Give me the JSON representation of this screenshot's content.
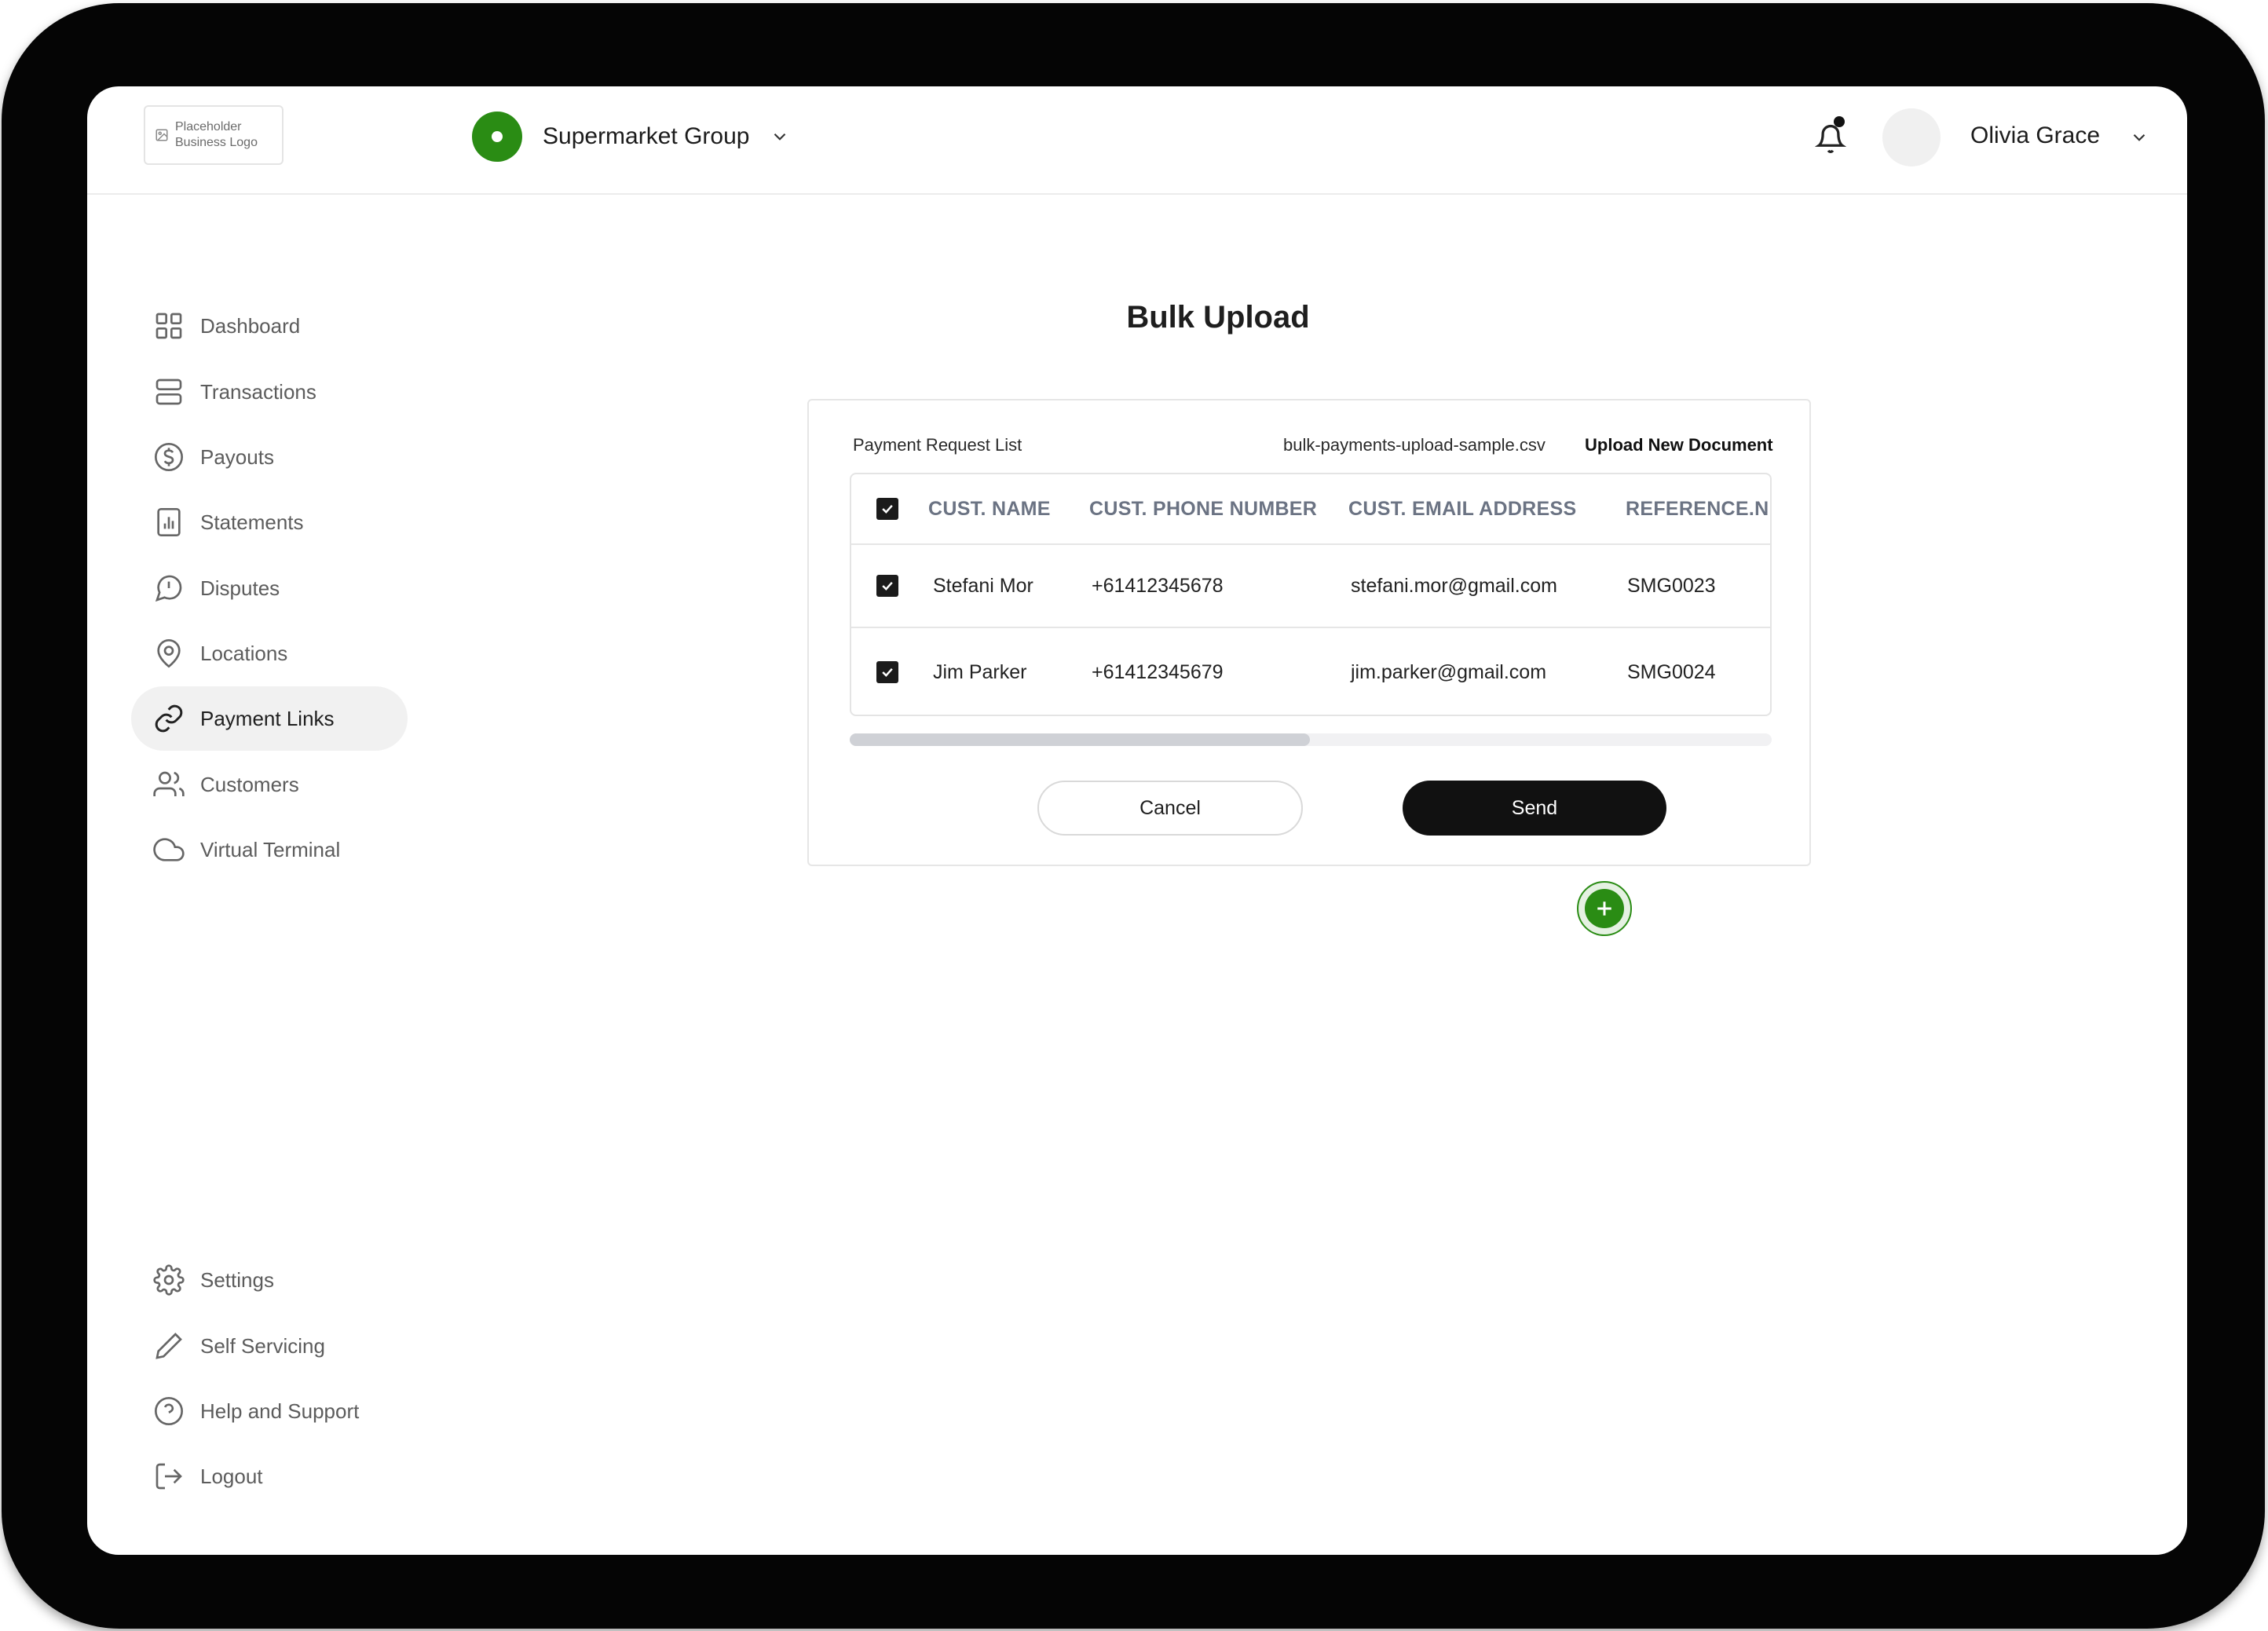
{
  "header": {
    "logo_text": "Placeholder Business Logo",
    "org_name": "Supermarket Group",
    "user_name": "Olivia Grace"
  },
  "sidebar": {
    "items": [
      {
        "label": "Dashboard",
        "icon": "grid-icon"
      },
      {
        "label": "Transactions",
        "icon": "transactions-icon"
      },
      {
        "label": "Payouts",
        "icon": "dollar-circle-icon"
      },
      {
        "label": "Statements",
        "icon": "bar-chart-icon"
      },
      {
        "label": "Disputes",
        "icon": "alert-message-icon"
      },
      {
        "label": "Locations",
        "icon": "map-pin-icon"
      },
      {
        "label": "Payment Links",
        "icon": "link-icon",
        "active": true
      },
      {
        "label": "Customers",
        "icon": "users-icon"
      },
      {
        "label": "Virtual Terminal",
        "icon": "cloud-icon"
      }
    ],
    "bottom_items": [
      {
        "label": "Settings",
        "icon": "gear-icon"
      },
      {
        "label": "Self Servicing",
        "icon": "pencil-icon"
      },
      {
        "label": "Help and Support",
        "icon": "help-circle-icon"
      },
      {
        "label": "Logout",
        "icon": "logout-icon"
      }
    ]
  },
  "main": {
    "title": "Bulk Upload",
    "card": {
      "label": "Payment Request List",
      "file_name": "bulk-payments-upload-sample.csv",
      "upload_label": "Upload New Document",
      "table": {
        "columns": [
          "CUST. NAME",
          "CUST. PHONE NUMBER",
          "CUST. EMAIL ADDRESS",
          "REFERENCE.N"
        ],
        "rows": [
          {
            "checked": true,
            "cells": [
              "Stefani Mor",
              "+61412345678",
              "stefani.mor@gmail.com",
              "SMG0023"
            ]
          },
          {
            "checked": true,
            "cells": [
              "Jim Parker",
              "+61412345679",
              "jim.parker@gmail.com",
              "SMG0024"
            ]
          }
        ]
      },
      "cancel_label": "Cancel",
      "send_label": "Send"
    }
  },
  "colors": {
    "brand_green": "#2a8c14",
    "button_dark": "#111111",
    "active_nav_bg": "#f1f1f1"
  }
}
